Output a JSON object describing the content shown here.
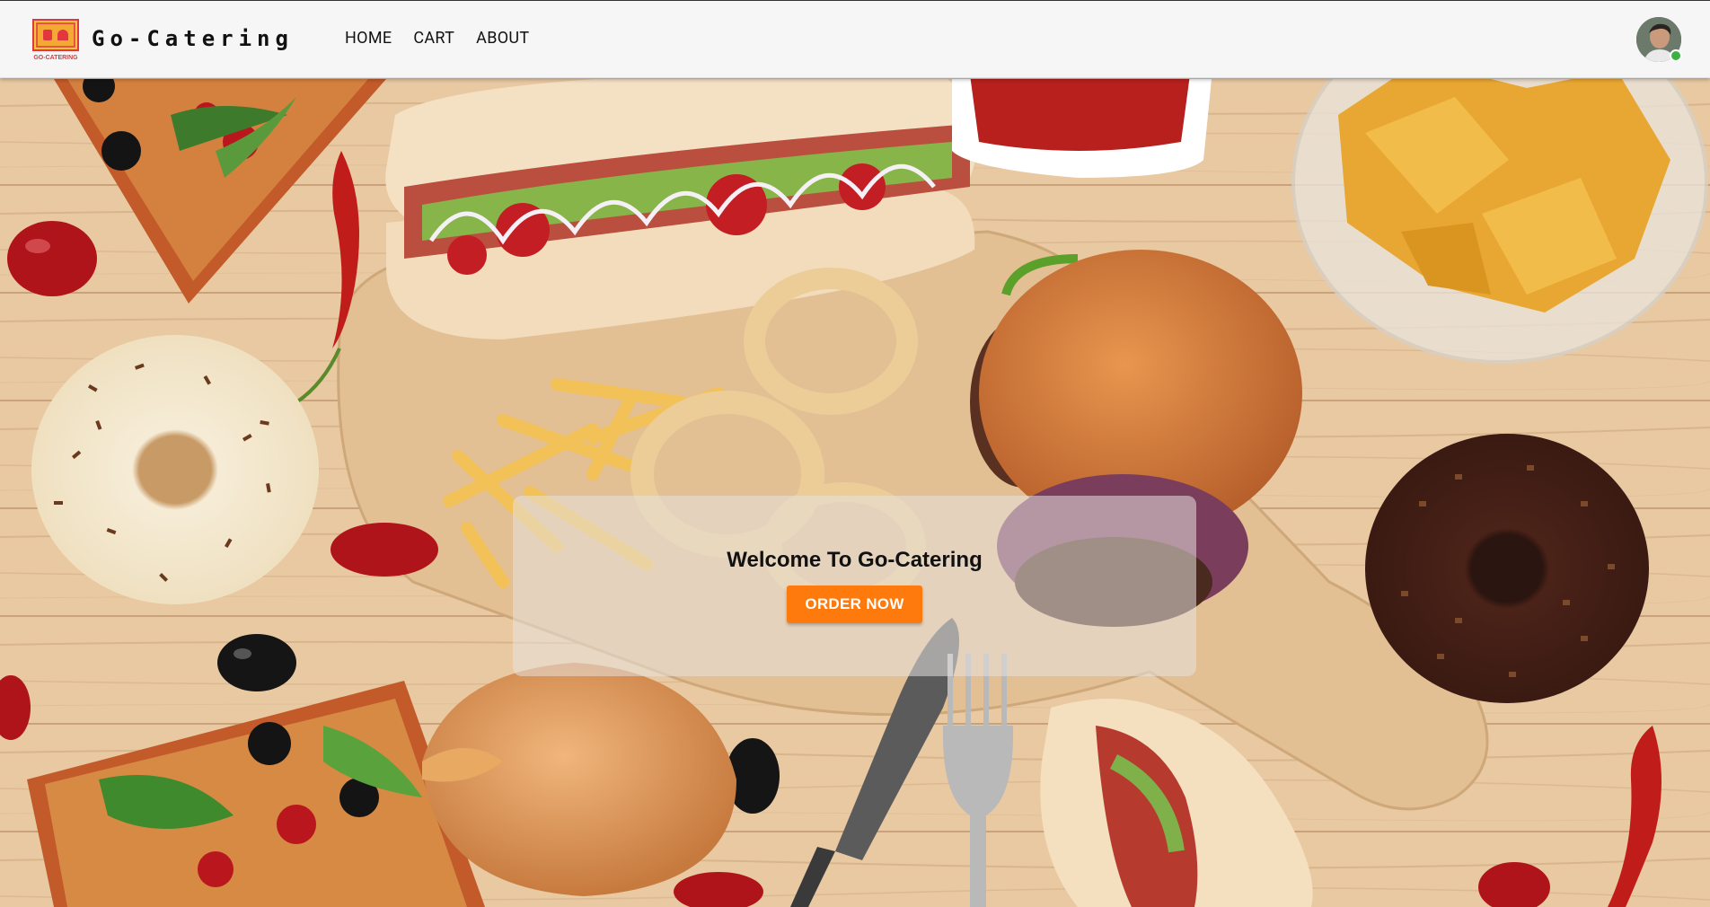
{
  "brand": {
    "name": "Go-Catering",
    "logo_caption": "GO-CATERING",
    "logo_icon": "food-tray-icon"
  },
  "nav": {
    "home": "HOME",
    "cart": "CART",
    "about": "ABOUT"
  },
  "user": {
    "avatar_icon": "user-avatar",
    "status": "online"
  },
  "hero": {
    "title": "Welcome To Go-Catering",
    "cta": "ORDER NOW",
    "background": "food-spread-photo"
  },
  "colors": {
    "accent": "#ff7a0d",
    "header_bg": "#f6f6f6",
    "logo_red": "#e2373f",
    "logo_yellow": "#f8c242",
    "status_green": "#3cb043"
  }
}
